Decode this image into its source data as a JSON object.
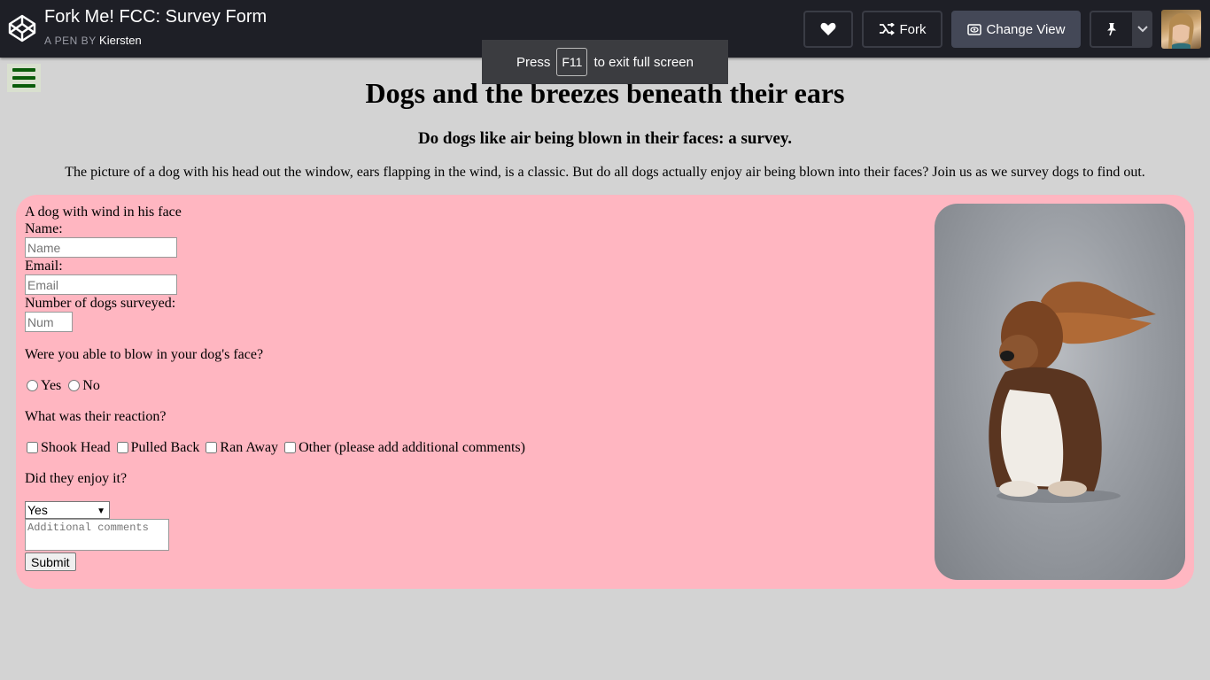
{
  "codepen": {
    "pen_title": "Fork Me! FCC: Survey Form",
    "by_label": "A PEN BY",
    "author": "Kiersten",
    "fork_label": "Fork",
    "change_view_label": "Change View"
  },
  "toast": {
    "press": "Press",
    "key": "F11",
    "suffix": "to exit full screen"
  },
  "page": {
    "title": "Dogs and the breezes beneath their ears",
    "subtitle": "Do dogs like air being blown in their faces: a survey.",
    "intro": "The picture of a dog with his head out the window, ears flapping in the wind, is a classic. But do all dogs actually enjoy air being blown into their faces? Join us as we survey dogs to find out."
  },
  "form": {
    "image_alt": "A dog with wind in his face",
    "name_label": "Name:",
    "name_placeholder": "Name",
    "email_label": "Email:",
    "email_placeholder": "Email",
    "num_label": "Number of dogs surveyed:",
    "num_placeholder": "Num",
    "q1": "Were you able to blow in your dog's face?",
    "q1_options": [
      "Yes",
      "No"
    ],
    "q2": "What was their reaction?",
    "q2_options": [
      "Shook Head",
      "Pulled Back",
      "Ran Away",
      "Other (please add additional comments)"
    ],
    "q3": "Did they enjoy it?",
    "q3_selected": "Yes",
    "comments_placeholder": "Additional comments",
    "submit_label": "Submit"
  },
  "colors": {
    "background": "#d3d3d3",
    "card": "#ffb6c1",
    "topbar": "#1e1f26",
    "menu_icon": "#0a5c0a"
  },
  "icons": [
    "codepen-logo-icon",
    "heart-icon",
    "fork-icon",
    "eye-icon",
    "pin-icon",
    "chevron-down-icon",
    "hamburger-menu-icon"
  ]
}
